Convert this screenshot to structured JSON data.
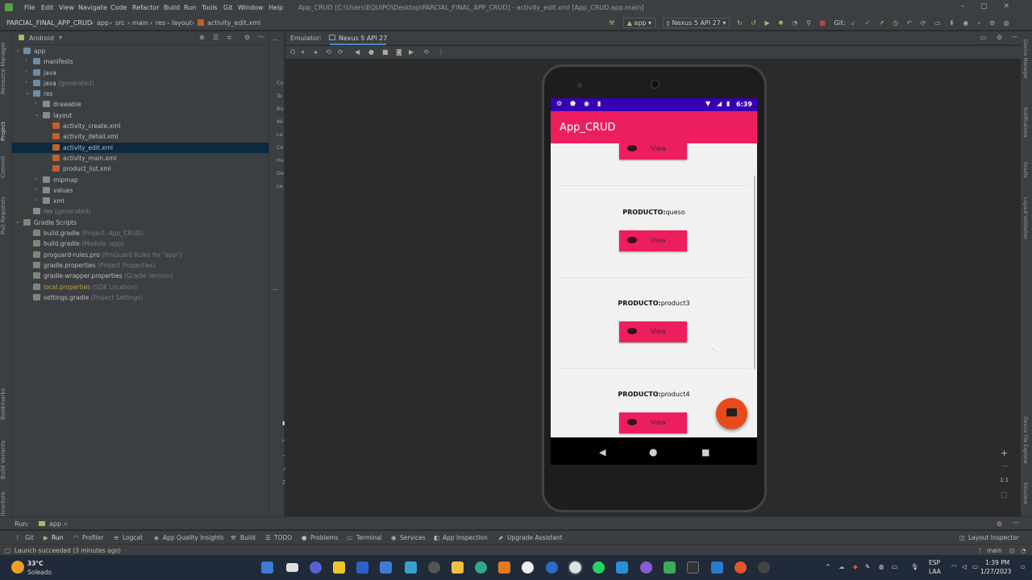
{
  "menu": [
    "File",
    "Edit",
    "View",
    "Navigate",
    "Code",
    "Refactor",
    "Build",
    "Run",
    "Tools",
    "Git",
    "Window",
    "Help"
  ],
  "window_title": "App_CRUD [C:\\Users\\EQUIPO\\Desktop\\PARCIAL_FINAL_APP_CRUD] - activity_edit.xml [App_CRUD.app.main]",
  "breadcrumb": [
    "PARCIAL_FINAL_APP_CRUD",
    "app",
    "src",
    "main",
    "res",
    "layout",
    "activity_edit.xml"
  ],
  "run_config": "app",
  "device_config": "Nexus 5 API 27",
  "git_label": "Git:",
  "project_view": "Android",
  "tree": [
    {
      "label": "app",
      "note": "",
      "level": 0,
      "kind": "folderb",
      "open": true
    },
    {
      "label": "manifests",
      "note": "",
      "level": 1,
      "kind": "folderb",
      "open": false
    },
    {
      "label": "java",
      "note": "",
      "level": 1,
      "kind": "folderb",
      "open": false
    },
    {
      "label": "java",
      "note": "(generated)",
      "level": 1,
      "kind": "folderb",
      "open": false
    },
    {
      "label": "res",
      "note": "",
      "level": 1,
      "kind": "folderb",
      "open": true
    },
    {
      "label": "drawable",
      "note": "",
      "level": 2,
      "kind": "folder",
      "open": false
    },
    {
      "label": "layout",
      "note": "",
      "level": 2,
      "kind": "folder",
      "open": true
    },
    {
      "label": "activity_create.xml",
      "note": "",
      "level": 3,
      "kind": "xml"
    },
    {
      "label": "activity_detail.xml",
      "note": "",
      "level": 3,
      "kind": "xml"
    },
    {
      "label": "activity_edit.xml",
      "note": "",
      "level": 3,
      "kind": "xml",
      "selected": true
    },
    {
      "label": "activity_main.xml",
      "note": "",
      "level": 3,
      "kind": "xml"
    },
    {
      "label": "product_list.xml",
      "note": "",
      "level": 3,
      "kind": "xml"
    },
    {
      "label": "mipmap",
      "note": "",
      "level": 2,
      "kind": "folder",
      "open": false
    },
    {
      "label": "values",
      "note": "",
      "level": 2,
      "kind": "folder",
      "open": false
    },
    {
      "label": "xml",
      "note": "",
      "level": 2,
      "kind": "folder",
      "open": false
    },
    {
      "label": "res",
      "note": "(generated)",
      "level": 1,
      "kind": "folder",
      "dim": true
    },
    {
      "label": "Gradle Scripts",
      "note": "",
      "level": 0,
      "kind": "grad",
      "open": true
    },
    {
      "label": "build.gradle",
      "note": "(Project: App_CRUD)",
      "level": 1,
      "kind": "grad"
    },
    {
      "label": "build.gradle",
      "note": "(Module :app)",
      "level": 1,
      "kind": "grad"
    },
    {
      "label": "proguard-rules.pro",
      "note": "(ProGuard Rules for \"app\")",
      "level": 1,
      "kind": "grad"
    },
    {
      "label": "gradle.properties",
      "note": "(Project Properties)",
      "level": 1,
      "kind": "grad"
    },
    {
      "label": "gradle-wrapper.properties",
      "note": "(Gradle Version)",
      "level": 1,
      "kind": "grad"
    },
    {
      "label": "local.properties",
      "note": "(SDK Location)",
      "level": 1,
      "kind": "grad",
      "yellow": true
    },
    {
      "label": "settings.gradle",
      "note": "(Project Settings)",
      "level": 1,
      "kind": "grad"
    }
  ],
  "left_tabs": [
    "Resource Manager",
    "Project",
    "Commit",
    "Pull Requests",
    "Bookmarks",
    "Build Variants",
    "Structure"
  ],
  "right_tabs": [
    "Device Manager",
    "Notifications",
    "Gradle",
    "Layout Validation",
    "Device File Explorer",
    "Emulator"
  ],
  "mid_strip": [
    "Co",
    "Te",
    "Bu",
    "Wi",
    "La",
    "Co",
    "He",
    "Ge",
    "Le"
  ],
  "emulator": {
    "label": "Emulator:",
    "tab": "Nexus 5 API 27"
  },
  "phone": {
    "time": "6:39",
    "app_title": "App_CRUD",
    "product_prefix": "PRODUCTO:",
    "view_label": "View",
    "items": [
      "queso",
      "product3",
      "product4"
    ]
  },
  "bottom_run": {
    "run": "Run:",
    "config": "app"
  },
  "bottom_tabs": [
    "Git",
    "Run",
    "Profiler",
    "Logcat",
    "App Quality Insights",
    "Build",
    "TODO",
    "Problems",
    "Terminal",
    "Services",
    "App Inspection",
    "Upgrade Assistant"
  ],
  "layout_inspector": "Layout Inspector",
  "status_message": "Launch succeeded (3 minutes ago)",
  "branch": "main",
  "taskbar": {
    "temp": "33°C",
    "weather": "Soleado",
    "lang": "ESP",
    "lang2": "LAA",
    "time": "1:39 PM",
    "date": "1/27/2023"
  },
  "zoom_reset": "1:1",
  "colors": {
    "accent": "#ec1e5e",
    "statusbar": "#3700b3",
    "fab": "#ea4a1b"
  }
}
